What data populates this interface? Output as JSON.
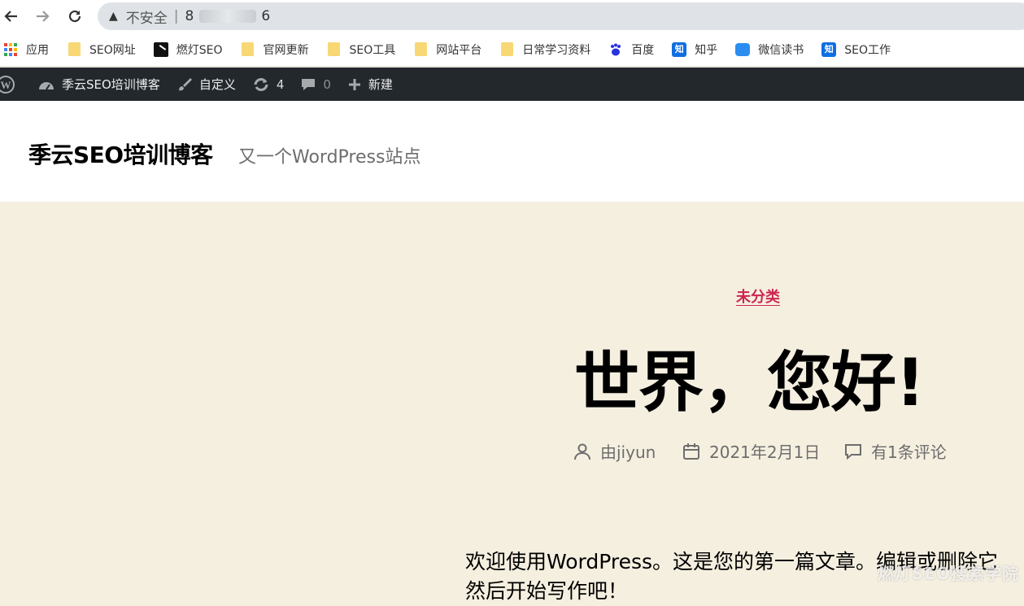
{
  "browser": {
    "security_label": "不安全",
    "url_prefix": "8",
    "url_suffix": "6"
  },
  "bookmarks": [
    {
      "label": "应用",
      "icon": "apps-grid-icon"
    },
    {
      "label": "SEO网址",
      "icon": "folder-icon"
    },
    {
      "label": "燃灯SEO",
      "icon": "ranDeng-icon"
    },
    {
      "label": "官网更新",
      "icon": "folder-icon"
    },
    {
      "label": "SEO工具",
      "icon": "folder-icon"
    },
    {
      "label": "网站平台",
      "icon": "folder-icon"
    },
    {
      "label": "日常学习资料",
      "icon": "folder-icon"
    },
    {
      "label": "百度",
      "icon": "baidu-paw-icon"
    },
    {
      "label": "知乎",
      "icon": "zhihu-icon"
    },
    {
      "label": "微信读书",
      "icon": "weread-icon"
    },
    {
      "label": "SEO工作",
      "icon": "zhihu-icon"
    }
  ],
  "adminbar": {
    "site_name": "季云SEO培训博客",
    "customize": "自定义",
    "updates_count": "4",
    "comments_count": "0",
    "new_label": "新建"
  },
  "site": {
    "title": "季云SEO培训博客",
    "description": "又一个WordPress站点"
  },
  "post": {
    "category": "未分类",
    "title": "世界，您好!",
    "author": "由jiyun",
    "date": "2021年2月1日",
    "comments": "有1条评论",
    "excerpt_line1": "欢迎使用WordPress。这是您的第一篇文章。编辑或删除它",
    "excerpt_line2": "然后开始写作吧！"
  },
  "watermark": "燃灯SEO搜索学院",
  "colors": {
    "accent": "#cd2653",
    "adminbar_bg": "#23282d",
    "content_bg": "#f5efe0"
  }
}
